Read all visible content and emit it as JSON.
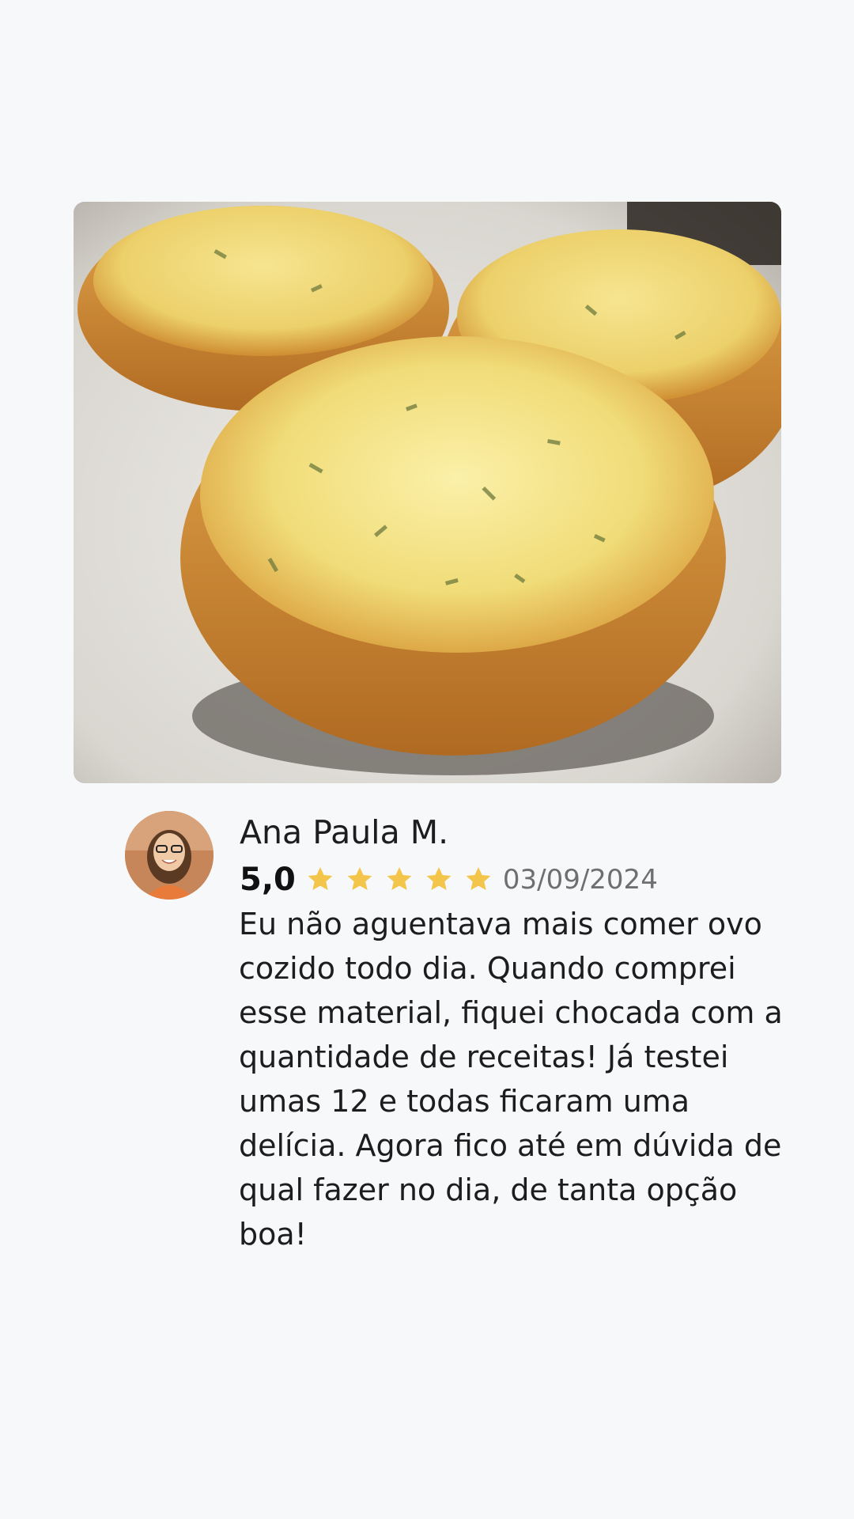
{
  "review": {
    "photo_icon": "food-photo-quiche",
    "avatar_icon": "user-avatar",
    "reviewer_name": "Ana Paula M.",
    "rating_value": "5,0",
    "rating": 5,
    "rating_max": 5,
    "star_color": "#f3c64b",
    "date": "03/09/2024",
    "text": "Eu não aguentava mais comer ovo cozido todo dia. Quando comprei esse material, fiquei chocada com a quantidade de receitas! Já testei umas 12 e todas ficaram uma delícia. Agora fico até em dúvida de qual fazer no dia, de tanta opção boa!"
  }
}
